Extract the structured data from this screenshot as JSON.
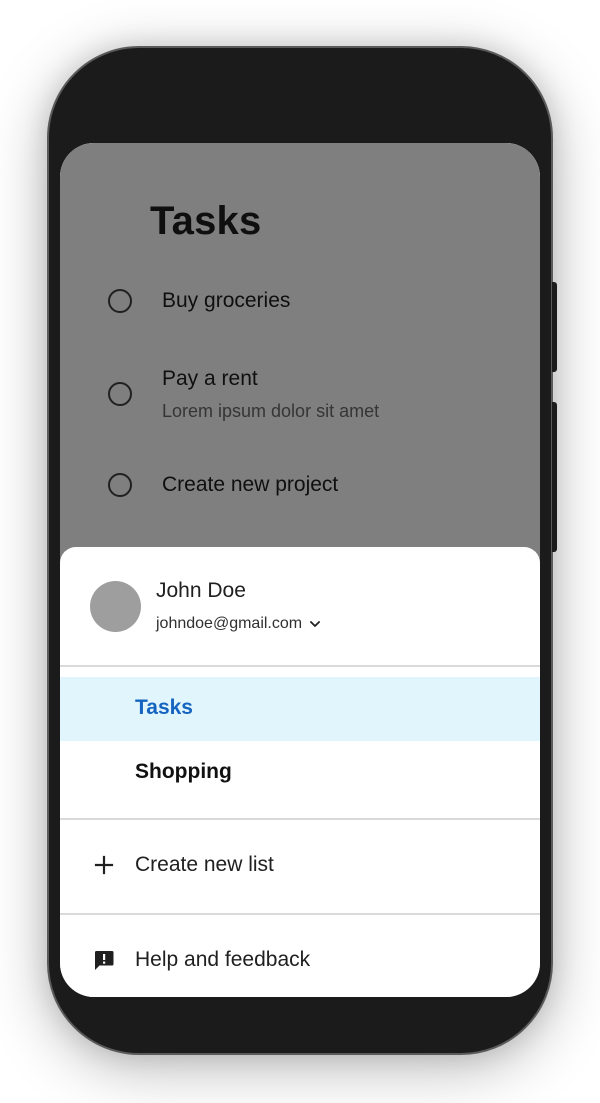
{
  "app": {
    "title": "Tasks",
    "tasks": [
      {
        "title": "Buy groceries",
        "note": "",
        "completed": false
      },
      {
        "title": "Pay a rent",
        "note": "Lorem ipsum dolor sit amet",
        "completed": false
      },
      {
        "title": "Create new project",
        "note": "",
        "completed": false
      }
    ]
  },
  "drawer": {
    "account": {
      "name": "John Doe",
      "email": "johndoe@gmail.com",
      "switcher_icon": "chevron-down-icon"
    },
    "lists": [
      {
        "label": "Tasks",
        "active": true
      },
      {
        "label": "Shopping",
        "active": false
      }
    ],
    "create_list": {
      "label": "Create new list",
      "icon": "plus-icon"
    },
    "help": {
      "label": "Help and feedback",
      "icon": "feedback-icon"
    }
  },
  "colors": {
    "active_list_text": "#1565c0",
    "active_list_background": "#e1f5fd",
    "scrim": "rgba(0,0,0,0.5)",
    "avatar": "#9e9e9e",
    "phone_frame": "#1b1b1b"
  }
}
